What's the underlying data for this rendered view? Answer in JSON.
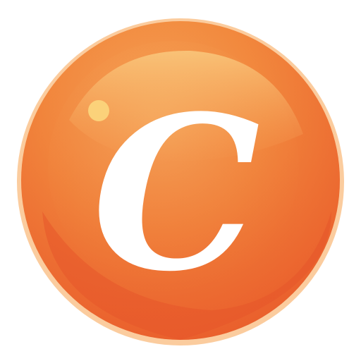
{
  "icon": {
    "name": "orange-c-orb-app-icon",
    "letter": "C",
    "colors": {
      "background": "#ffffff",
      "orb_highlight": "#f8b05a",
      "orb_mid": "#f28a3c",
      "orb_shadow": "#e85a2a",
      "orb_rim": "#f7a04d",
      "glint": "#fbd27a",
      "letter": "#ffffff"
    }
  }
}
